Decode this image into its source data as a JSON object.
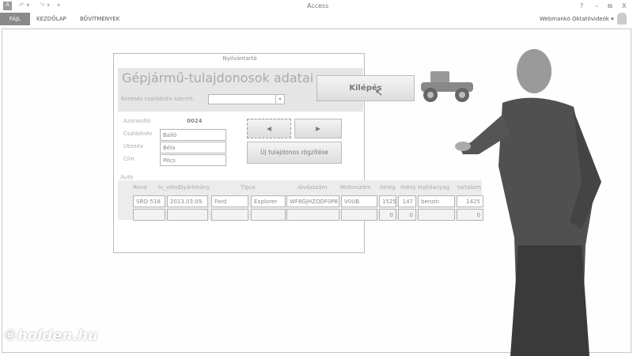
{
  "app": {
    "title": "Access",
    "user": "Webmankó Oktatóvideók",
    "help": "?",
    "minimize": "–",
    "restore": "⧉",
    "close": "X"
  },
  "ribbon": {
    "tabs": [
      "FÁJL",
      "KEZDŐLAP",
      "BŐVÍTMÉNYEK"
    ]
  },
  "form": {
    "window_title": "Nyilvántartó",
    "title": "Gépjármű-tulajdonosok adatai",
    "search_label": "Keresés családnév szerint:",
    "search_value": "",
    "exit_button": "Kilépés",
    "fields": {
      "id_label": "Azonosító",
      "id_value": "0024",
      "lastname_label": "Családnév",
      "lastname_value": "Balló",
      "firstname_label": "Utónév",
      "firstname_value": "Béla",
      "address_label": "Cím",
      "address_value": "Pécs"
    },
    "prev_icon": "◀",
    "next_icon": "▶",
    "new_owner_button": "Új tulajdonos rögzítése",
    "subform_label": "Auto",
    "columns": [
      "Rend",
      "Iv_vétel",
      "Gyártmány",
      "Típus",
      "Alvázszám",
      "Motorszám",
      "ömeg",
      "mény",
      "Hajtóanyag",
      "tartalom"
    ],
    "rows": [
      [
        "SRQ-518",
        "2013.03.09.",
        "Ford",
        "Explorer",
        "WF8GJHZQDF0P8",
        "V0UB",
        "1525",
        "147",
        "benzin",
        "1425"
      ],
      [
        "",
        "",
        "",
        "",
        "",
        "",
        "0",
        "0",
        "",
        "0"
      ]
    ]
  },
  "watermark": "©holden.hu"
}
